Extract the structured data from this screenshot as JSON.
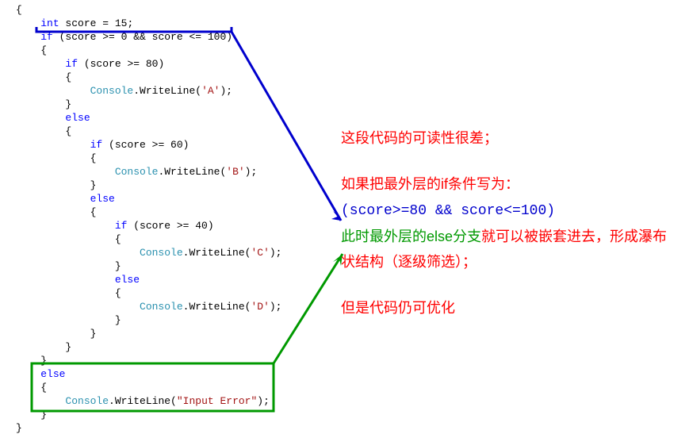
{
  "code": {
    "l1": "{",
    "l2a": "    ",
    "l2_kw1": "int",
    "l2b": " score = 15;",
    "l3a": "    ",
    "l3_kw1": "if",
    "l3b": " (score >= 0 && score <= 100)",
    "l4": "    {",
    "l5a": "        ",
    "l5_kw1": "if",
    "l5b": " (score >= 80)",
    "l6": "        {",
    "l7a": "            ",
    "l7_type": "Console",
    "l7b": ".WriteLine(",
    "l7_str": "'A'",
    "l7c": ");",
    "l8": "        }",
    "l9a": "        ",
    "l9_kw": "else",
    "l10": "        {",
    "l11a": "            ",
    "l11_kw": "if",
    "l11b": " (score >= 60)",
    "l12": "            {",
    "l13a": "                ",
    "l13_type": "Console",
    "l13b": ".WriteLine(",
    "l13_str": "'B'",
    "l13c": ");",
    "l14": "            }",
    "l15a": "            ",
    "l15_kw": "else",
    "l16": "            {",
    "l17a": "                ",
    "l17_kw": "if",
    "l17b": " (score >= 40)",
    "l18": "                {",
    "l19a": "                    ",
    "l19_type": "Console",
    "l19b": ".WriteLine(",
    "l19_str": "'C'",
    "l19c": ");",
    "l20": "                }",
    "l21a": "                ",
    "l21_kw": "else",
    "l22": "                {",
    "l23a": "                    ",
    "l23_type": "Console",
    "l23b": ".WriteLine(",
    "l23_str": "'D'",
    "l23c": ");",
    "l24": "                }",
    "l25": "            }",
    "l26": "        }",
    "l27": "    }",
    "l28a": "    ",
    "l28_kw": "else",
    "l29": "    {",
    "l30a": "        ",
    "l30_type": "Console",
    "l30b": ".WriteLine(",
    "l30_str": "\"Input Error\"",
    "l30c": ");",
    "l31": "    }",
    "l32": "}"
  },
  "anno": {
    "p1": "这段代码的可读性很差；",
    "p2a": "如果把最外层的if条件写为：",
    "p2b": "(score>=80 && score<=100)",
    "p3a": "此时最外层的else分支",
    "p3b": "就可以被嵌套进去，形成瀑布状结构（逐级筛选）；",
    "p4": "但是代码仍可优化"
  }
}
